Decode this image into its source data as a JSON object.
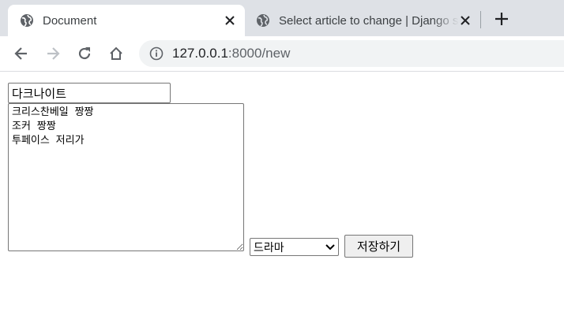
{
  "tabs": [
    {
      "title": "Document",
      "icon": "globe-icon",
      "active": true
    },
    {
      "title": "Select article to change | Django site admin",
      "icon": "globe-icon",
      "active": false
    }
  ],
  "toolbar": {
    "url_host": "127.0.0.1",
    "url_rest": ":8000/new"
  },
  "form": {
    "title_value": "다크나이트",
    "content_value": "크리스찬베일 짱짱\n조커 짱짱\n투페이스 저리가",
    "genre_selected": "드라마",
    "save_label": "저장하기"
  }
}
